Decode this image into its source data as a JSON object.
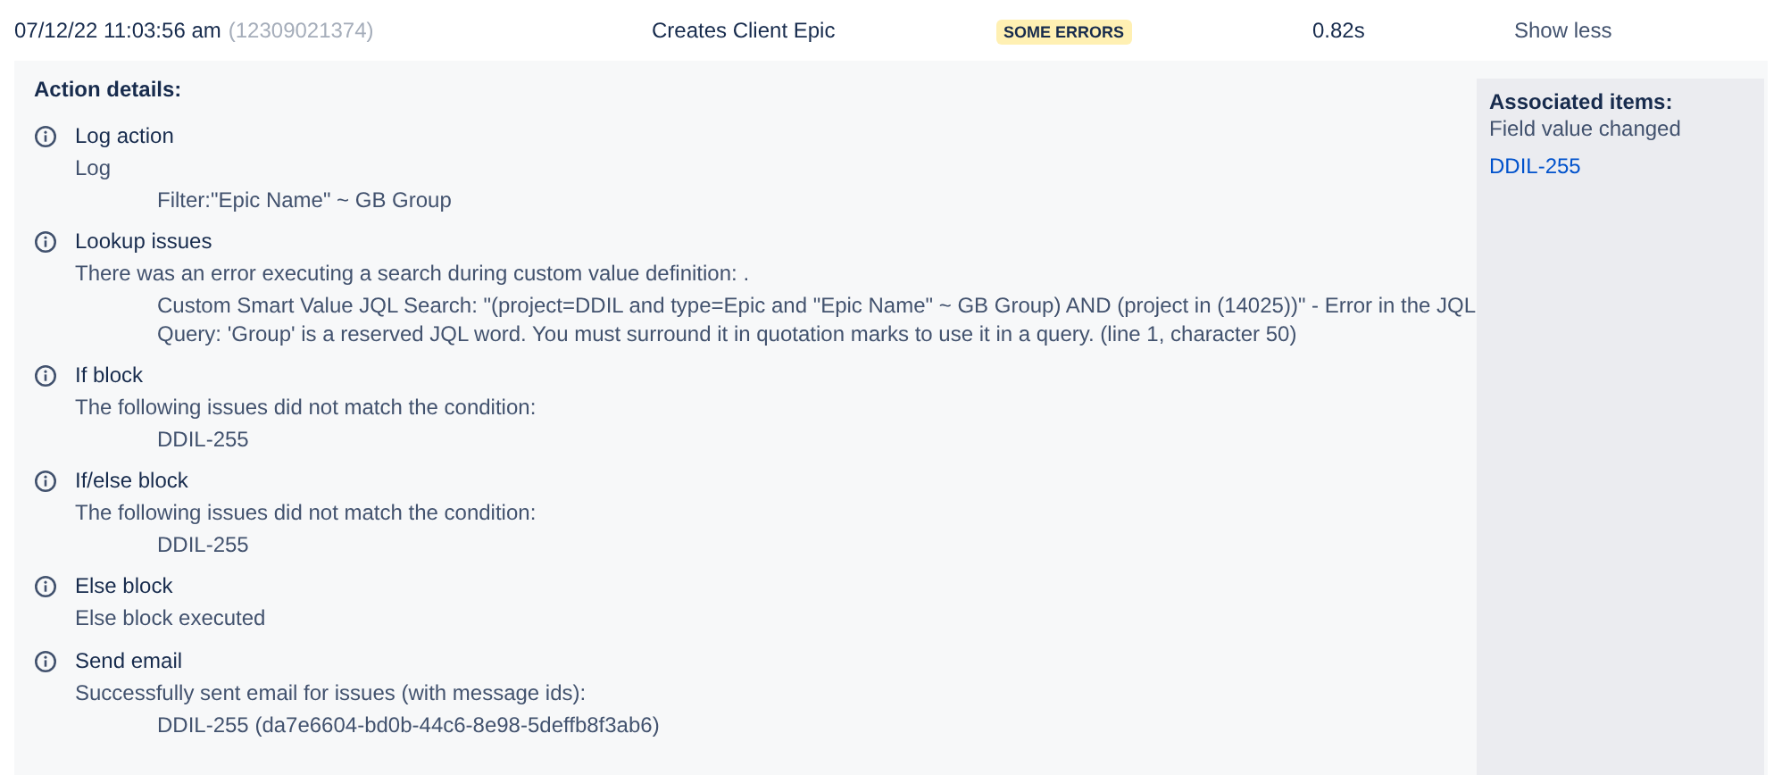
{
  "header": {
    "timestamp": "07/12/22 11:03:56 am",
    "run_id": "(12309021374)",
    "rule": "Creates Client Epic",
    "status": "SOME ERRORS",
    "duration": "0.82s",
    "toggle": "Show less"
  },
  "details": {
    "heading": "Action details:",
    "actions": [
      {
        "title": "Log action",
        "message": "Log",
        "details": [
          "Filter:\"Epic Name\" ~ GB Group"
        ]
      },
      {
        "title": "Lookup issues",
        "message": "There was an error executing a search during custom value definition: .",
        "details": [
          "Custom Smart Value JQL Search: \"(project=DDIL and type=Epic and \"Epic Name\" ~ GB Group) AND (project in (14025))\" - Error in the JQL Query: 'Group' is a reserved JQL word. You must surround it in quotation marks to use it in a query. (line 1, character 50)"
        ]
      },
      {
        "title": "If block",
        "message": "The following issues did not match the condition:",
        "details": [
          "DDIL-255"
        ]
      },
      {
        "title": "If/else block",
        "message": "The following issues did not match the condition:",
        "details": [
          "DDIL-255"
        ]
      },
      {
        "title": "Else block",
        "message": "Else block executed"
      },
      {
        "title": "Send email",
        "message": "Successfully sent email for issues (with message ids):",
        "details": [
          "DDIL-255 (da7e6604-bd0b-44c6-8e98-5deffb8f3ab6)"
        ]
      }
    ]
  },
  "associated": {
    "heading": "Associated items:",
    "subheading": "Field value changed",
    "items": [
      "DDIL-255"
    ]
  }
}
